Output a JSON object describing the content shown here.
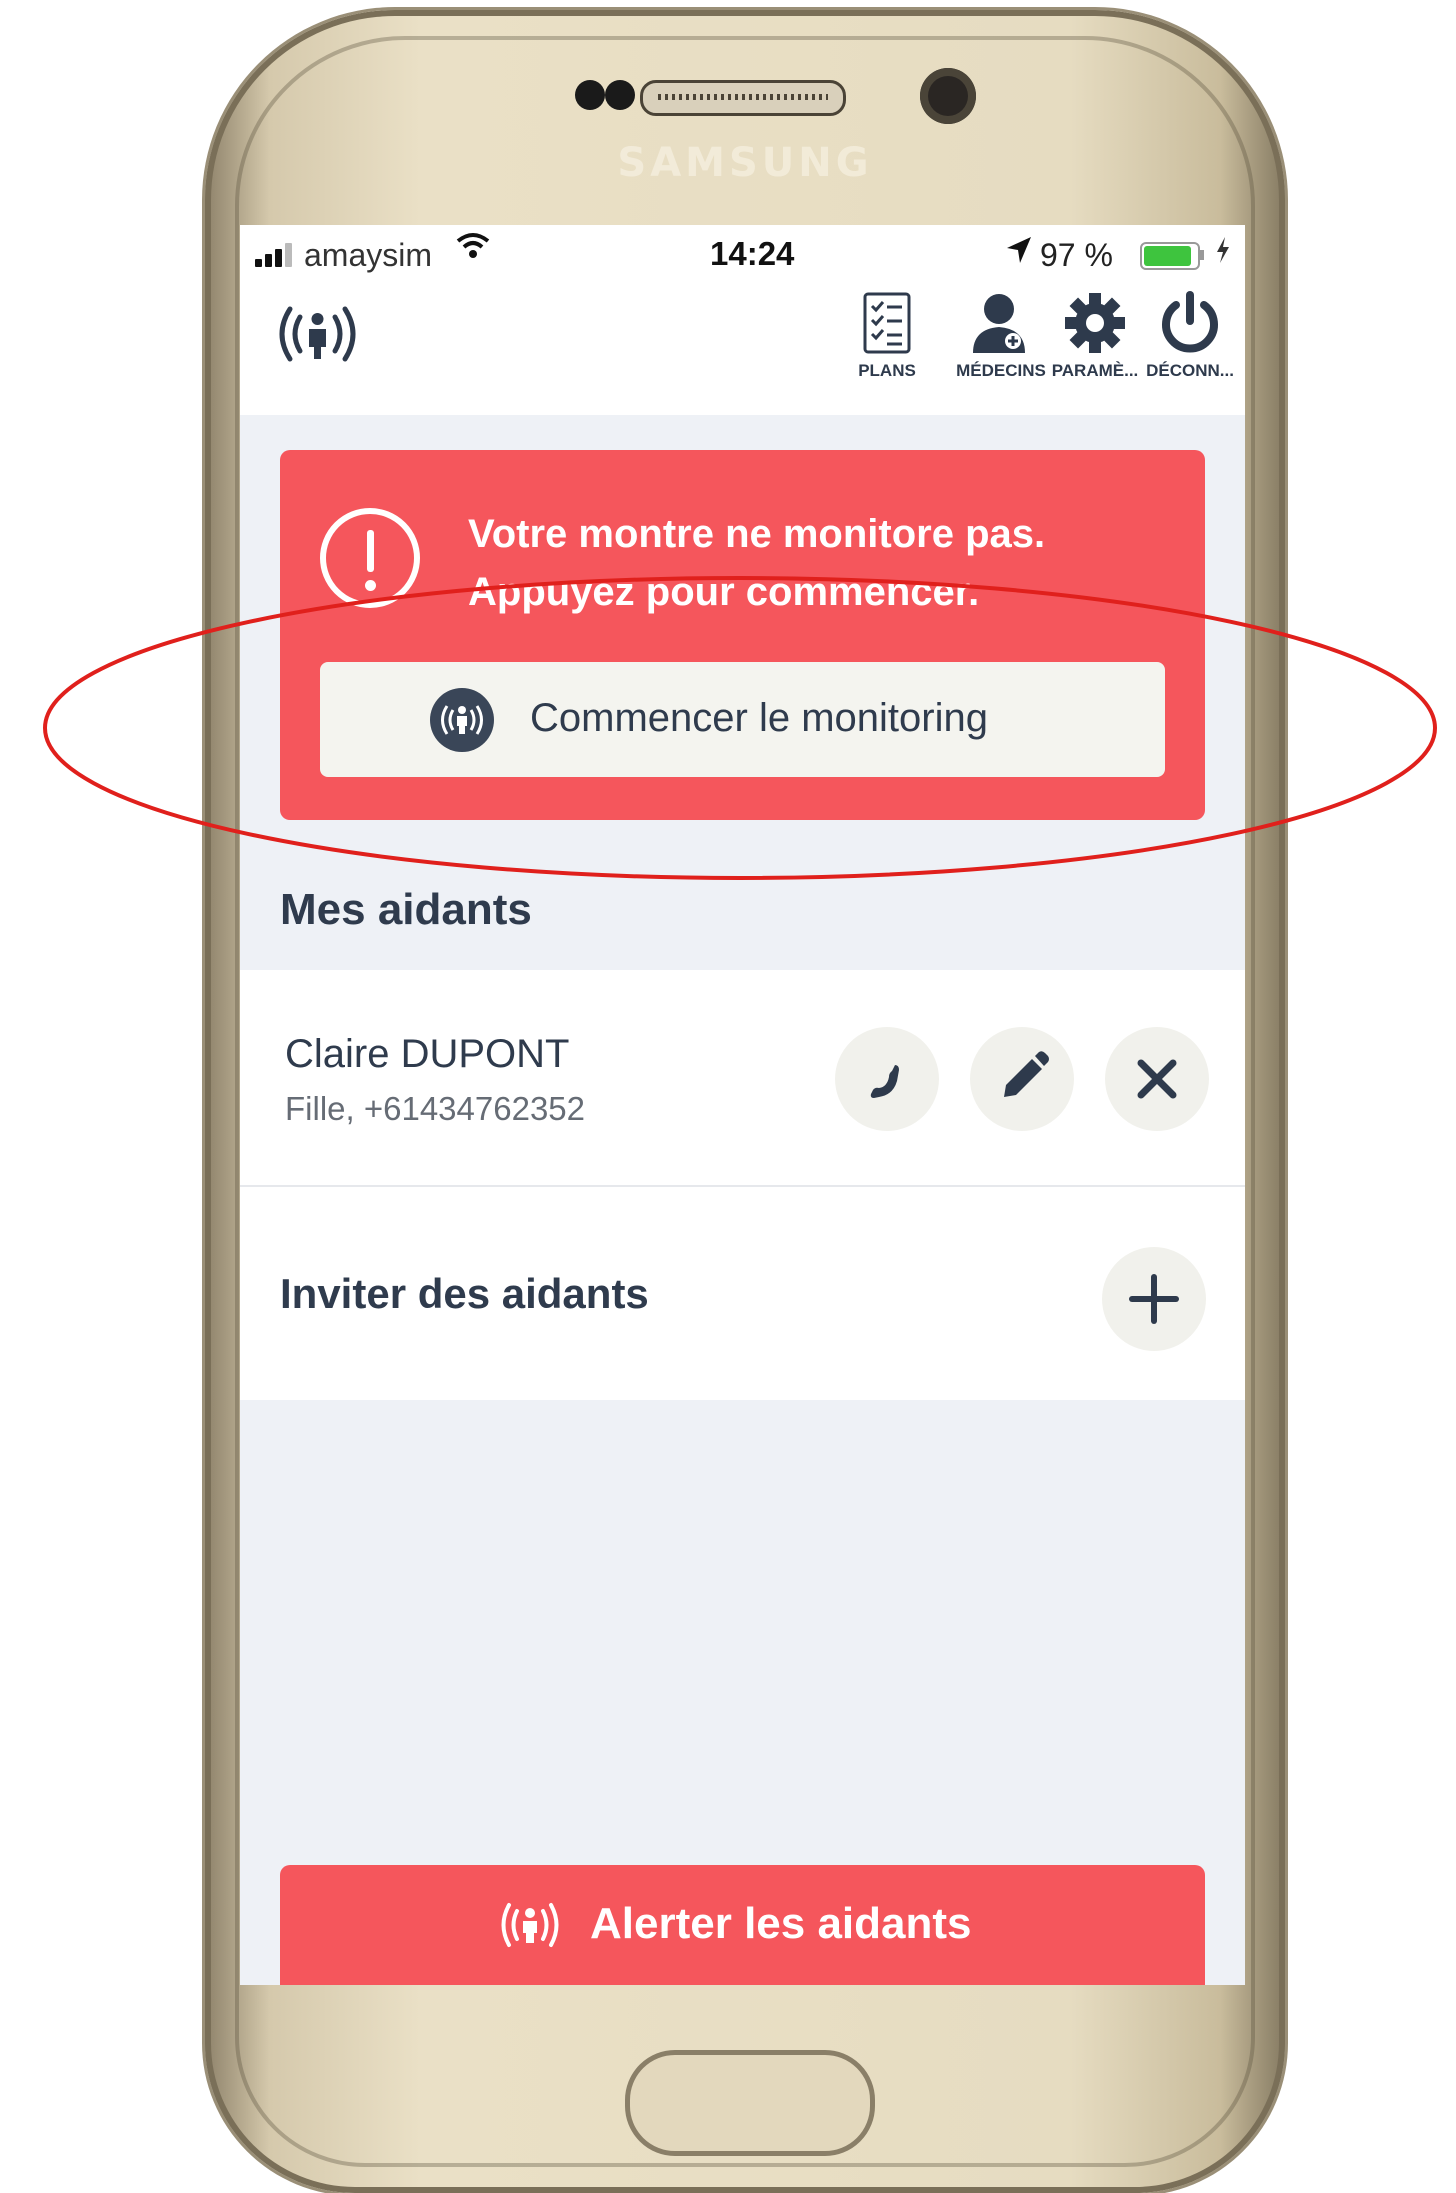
{
  "device": {
    "brand": "SAMSUNG"
  },
  "status_bar": {
    "carrier": "amaysim",
    "time": "14:24",
    "battery_text": "97 %",
    "battery_level": 0.97,
    "battery_color": "#3ec43e"
  },
  "app_bar": {
    "logo_icon": "broadcast-person-icon",
    "nav": [
      {
        "label": "PLANS",
        "icon": "checklist-icon"
      },
      {
        "label": "MÉDECINS",
        "icon": "doctor-icon"
      },
      {
        "label": "PARAMÈ...",
        "icon": "gear-icon"
      },
      {
        "label": "DÉCONN...",
        "icon": "power-icon"
      }
    ]
  },
  "alert": {
    "message": "Votre montre ne monitore pas. Appuyez pour commencer.",
    "button_label": "Commencer le monitoring",
    "color": "#f5565c"
  },
  "caregivers": {
    "title": "Mes aidants",
    "contacts": [
      {
        "name": "Claire DUPONT",
        "detail": "Fille, +61434762352"
      }
    ],
    "invite_label": "Inviter des aidants"
  },
  "bottom_action": {
    "label": "Alerter les aidants"
  },
  "annotation": {
    "color": "#e0201c"
  }
}
